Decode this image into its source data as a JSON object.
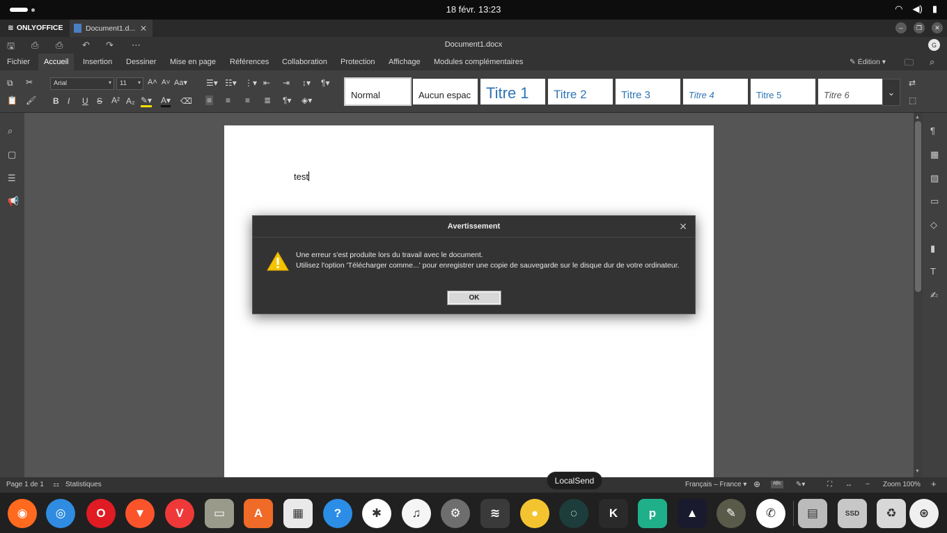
{
  "topbar": {
    "clock": "18 févr.  13:23",
    "icons": [
      "wifi-icon",
      "volume-icon",
      "battery-icon"
    ]
  },
  "tabbar": {
    "brand": "ONLYOFFICE",
    "doc_tab": "Document1.d...",
    "close_glyph": "✕"
  },
  "titlebar": {
    "title": "Document1.docx",
    "avatar": "G"
  },
  "menu": {
    "tabs": [
      "Fichier",
      "Accueil",
      "Insertion",
      "Dessiner",
      "Mise en page",
      "Références",
      "Collaboration",
      "Protection",
      "Affichage",
      "Modules complémentaires"
    ],
    "active": "Accueil",
    "edition": "Édition"
  },
  "toolbar": {
    "font_name": "Arial",
    "font_size": "11",
    "styles": [
      "Normal",
      "Aucun espac",
      "Titre 1",
      "Titre 2",
      "Titre 3",
      "Titre 4",
      "Titre 5",
      "Titre 6"
    ],
    "selected_style": "Normal",
    "heading_color": "#2e74b5"
  },
  "document": {
    "body_text": "test"
  },
  "dialog": {
    "title": "Avertissement",
    "line1": "Une erreur s'est produite lors du travail avec le document.",
    "line2": "Utilisez l'option 'Télécharger comme...' pour enregistrer une copie de sauvegarde sur le disque dur de votre ordinateur.",
    "ok": "OK",
    "warning_color": "#f5c400"
  },
  "statusbar": {
    "page": "Page 1 de 1",
    "stats": "Statistiques",
    "language": "Français – France",
    "zoom": "Zoom 100%"
  },
  "tooltip": "LocalSend",
  "dock": {
    "apps": [
      {
        "name": "firefox-icon",
        "color": "#ff6a1f",
        "glyph": "◉"
      },
      {
        "name": "chrome-icon",
        "color": "#2f8ce0",
        "glyph": "◎"
      },
      {
        "name": "opera-icon",
        "color": "#e01b24",
        "glyph": "O"
      },
      {
        "name": "brave-icon",
        "color": "#fb542b",
        "glyph": "▼"
      },
      {
        "name": "vivaldi-icon",
        "color": "#ef3939",
        "glyph": "V"
      },
      {
        "name": "files-icon",
        "color": "#9a9a8a",
        "glyph": "▭"
      },
      {
        "name": "app-installer-icon",
        "color": "#f06a28",
        "glyph": "A"
      },
      {
        "name": "store-icon",
        "color": "#e9e9e9",
        "glyph": "▦"
      },
      {
        "name": "help-icon",
        "color": "#2c8de6",
        "glyph": "?"
      },
      {
        "name": "slack-icon",
        "color": "#ffffff",
        "glyph": "✱"
      },
      {
        "name": "music-icon",
        "color": "#f5f5f5",
        "glyph": "♫"
      },
      {
        "name": "settings-icon",
        "color": "#6e6e6e",
        "glyph": "⚙"
      },
      {
        "name": "onlyoffice-icon",
        "color": "#3a3a3a",
        "glyph": "≋"
      },
      {
        "name": "notes-icon",
        "color": "#f4c430",
        "glyph": "●"
      },
      {
        "name": "localsend-icon",
        "color": "#1c3d3b",
        "glyph": "◌"
      },
      {
        "name": "kdenlive-icon",
        "color": "#2a2a2a",
        "glyph": "K"
      },
      {
        "name": "pycharm-icon",
        "color": "#1fb08a",
        "glyph": "p"
      },
      {
        "name": "affinity-icon",
        "color": "#1a1a2e",
        "glyph": "▲"
      },
      {
        "name": "gimp-icon",
        "color": "#5a5a4a",
        "glyph": "✎"
      },
      {
        "name": "whatsapp-icon",
        "color": "#ffffff",
        "glyph": "✆"
      },
      {
        "name": "server-icon",
        "color": "#bbbbbb",
        "glyph": "▤"
      },
      {
        "name": "ssd-icon",
        "color": "#c7c7c7",
        "glyph": "SSD"
      },
      {
        "name": "trash-icon",
        "color": "#d8d8d8",
        "glyph": "♻"
      },
      {
        "name": "ubuntu-icon",
        "color": "#f0f0f0",
        "glyph": "⊛"
      }
    ]
  }
}
